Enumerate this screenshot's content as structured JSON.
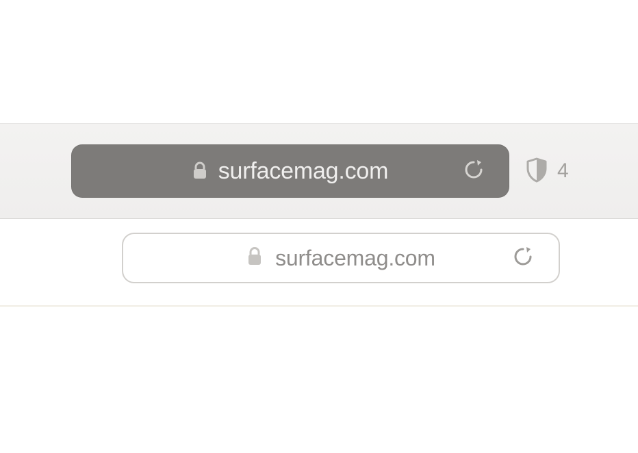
{
  "top_bar": {
    "url": "surfacemag.com",
    "tracker_count": "4"
  },
  "second_bar": {
    "url": "surfacemag.com"
  }
}
